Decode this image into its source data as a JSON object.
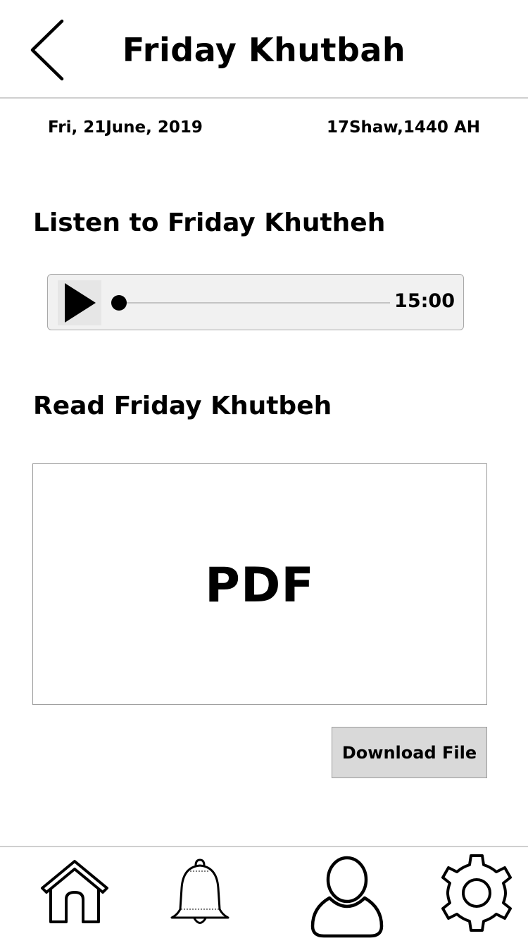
{
  "header": {
    "title": "Friday Khutbah",
    "back_icon": "chevron-left-icon"
  },
  "dates": {
    "gregorian": "Fri, 21June, 2019",
    "hijri": "17Shaw,1440 AH"
  },
  "listen_section": {
    "title": "Listen to Friday Khutheh",
    "player": {
      "play_icon": "play-icon",
      "progress": 0,
      "duration": "15:00"
    }
  },
  "read_section": {
    "title": "Read Friday Khutbeh",
    "preview_label": "PDF",
    "download_label": "Download File"
  },
  "bottom_nav": {
    "items": [
      {
        "name": "home",
        "icon": "home-icon"
      },
      {
        "name": "notifications",
        "icon": "bell-icon"
      },
      {
        "name": "profile",
        "icon": "user-icon"
      },
      {
        "name": "settings",
        "icon": "gear-icon"
      }
    ]
  }
}
